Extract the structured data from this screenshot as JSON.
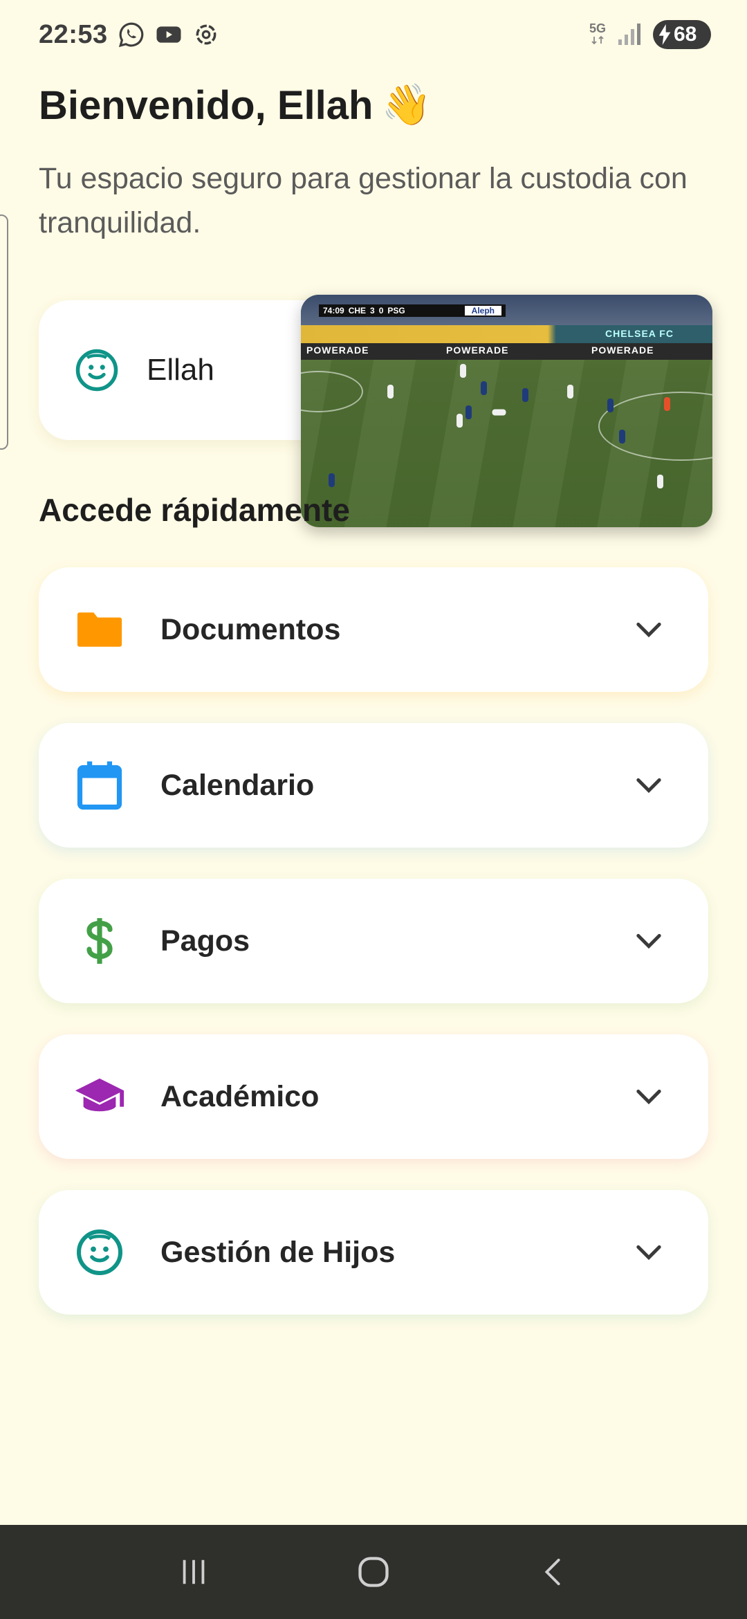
{
  "status_bar": {
    "time": "22:53",
    "network": "5G",
    "battery": "68",
    "icons": [
      "whatsapp-icon",
      "youtube-icon",
      "openai-icon",
      "signal-icon",
      "charging-icon"
    ]
  },
  "header": {
    "title": "Bienvenido, Ellah",
    "wave_emoji": "👋",
    "subtitle": "Tu espacio seguro para gestionar la custodia con tranquilidad."
  },
  "child_card": {
    "name": "Ellah",
    "icon": "child-face-icon"
  },
  "pip_video": {
    "score_time": "74:09",
    "home_team": "CHE",
    "home_score": "3",
    "away_score": "0",
    "away_team": "PSG",
    "sponsor": "Aleph",
    "board_text": "POWERADE",
    "banner_text": "CHELSEA FC"
  },
  "quick_access": {
    "title": "Accede rápidamente",
    "items": [
      {
        "label": "Documentos",
        "icon": "folder-icon",
        "color": "#FF9800"
      },
      {
        "label": "Calendario",
        "icon": "calendar-icon",
        "color": "#2196F3"
      },
      {
        "label": "Pagos",
        "icon": "dollar-icon",
        "color": "#43A047"
      },
      {
        "label": "Académico",
        "icon": "graduation-cap-icon",
        "color": "#9C27B0"
      },
      {
        "label": "Gestión de Hijos",
        "icon": "child-face-icon",
        "color": "#009688"
      }
    ]
  },
  "colors": {
    "background": "#FEFBE6",
    "teal": "#0F9488"
  }
}
